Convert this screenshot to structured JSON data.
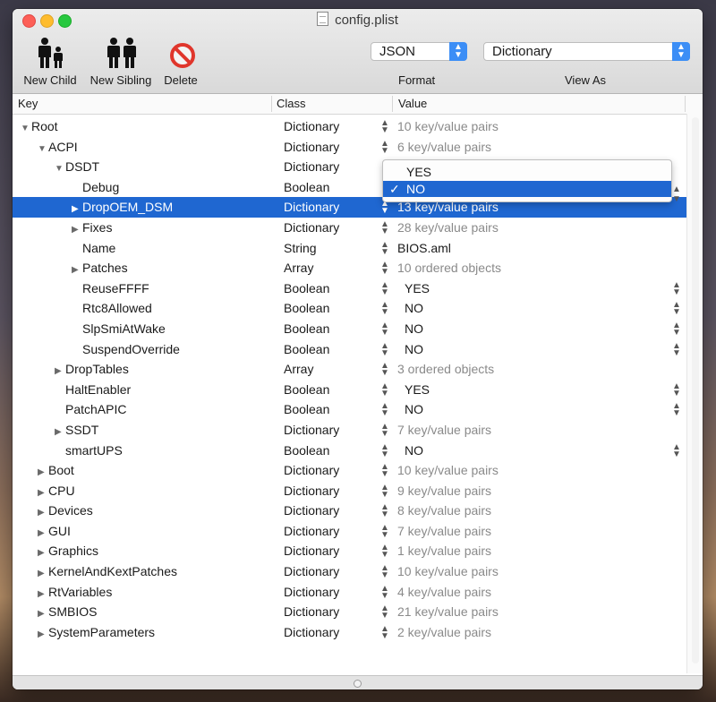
{
  "window": {
    "title": "config.plist"
  },
  "toolbar": {
    "new_child": "New Child",
    "new_sibling": "New Sibling",
    "delete": "Delete",
    "format": {
      "value": "JSON",
      "label": "Format"
    },
    "view_as": {
      "value": "Dictionary",
      "label": "View As"
    }
  },
  "columns": {
    "key": "Key",
    "class": "Class",
    "value": "Value"
  },
  "rows": [
    {
      "key": "Root",
      "indent": 0,
      "expandable": true,
      "expanded": true,
      "class": "Dictionary",
      "value": "10 key/value pairs",
      "kind": "summary"
    },
    {
      "key": "ACPI",
      "indent": 1,
      "expandable": true,
      "expanded": true,
      "class": "Dictionary",
      "value": "6 key/value pairs",
      "kind": "summary"
    },
    {
      "key": "DSDT",
      "indent": 2,
      "expandable": true,
      "expanded": true,
      "class": "Dictionary",
      "value": "",
      "kind": "summary"
    },
    {
      "key": "Debug",
      "indent": 3,
      "expandable": false,
      "class": "Boolean",
      "value": "",
      "kind": "bool"
    },
    {
      "key": "DropOEM_DSM",
      "indent": 3,
      "expandable": true,
      "expanded": false,
      "class": "Dictionary",
      "value": "13 key/value pairs",
      "kind": "summary",
      "selected": true
    },
    {
      "key": "Fixes",
      "indent": 3,
      "expandable": true,
      "expanded": false,
      "class": "Dictionary",
      "value": "28 key/value pairs",
      "kind": "summary"
    },
    {
      "key": "Name",
      "indent": 3,
      "expandable": false,
      "class": "String",
      "value": "BIOS.aml",
      "kind": "string"
    },
    {
      "key": "Patches",
      "indent": 3,
      "expandable": true,
      "expanded": false,
      "class": "Array",
      "value": "10 ordered objects",
      "kind": "summary"
    },
    {
      "key": "ReuseFFFF",
      "indent": 3,
      "expandable": false,
      "class": "Boolean",
      "value": "YES",
      "kind": "bool"
    },
    {
      "key": "Rtc8Allowed",
      "indent": 3,
      "expandable": false,
      "class": "Boolean",
      "value": "NO",
      "kind": "bool"
    },
    {
      "key": "SlpSmiAtWake",
      "indent": 3,
      "expandable": false,
      "class": "Boolean",
      "value": "NO",
      "kind": "bool"
    },
    {
      "key": "SuspendOverride",
      "indent": 3,
      "expandable": false,
      "class": "Boolean",
      "value": "NO",
      "kind": "bool"
    },
    {
      "key": "DropTables",
      "indent": 2,
      "expandable": true,
      "expanded": false,
      "class": "Array",
      "value": "3 ordered objects",
      "kind": "summary"
    },
    {
      "key": "HaltEnabler",
      "indent": 2,
      "expandable": false,
      "class": "Boolean",
      "value": "YES",
      "kind": "bool"
    },
    {
      "key": "PatchAPIC",
      "indent": 2,
      "expandable": false,
      "class": "Boolean",
      "value": "NO",
      "kind": "bool"
    },
    {
      "key": "SSDT",
      "indent": 2,
      "expandable": true,
      "expanded": false,
      "class": "Dictionary",
      "value": "7 key/value pairs",
      "kind": "summary"
    },
    {
      "key": "smartUPS",
      "indent": 2,
      "expandable": false,
      "class": "Boolean",
      "value": "NO",
      "kind": "bool"
    },
    {
      "key": "Boot",
      "indent": 1,
      "expandable": true,
      "expanded": false,
      "class": "Dictionary",
      "value": "10 key/value pairs",
      "kind": "summary"
    },
    {
      "key": "CPU",
      "indent": 1,
      "expandable": true,
      "expanded": false,
      "class": "Dictionary",
      "value": "9 key/value pairs",
      "kind": "summary"
    },
    {
      "key": "Devices",
      "indent": 1,
      "expandable": true,
      "expanded": false,
      "class": "Dictionary",
      "value": "8 key/value pairs",
      "kind": "summary"
    },
    {
      "key": "GUI",
      "indent": 1,
      "expandable": true,
      "expanded": false,
      "class": "Dictionary",
      "value": "7 key/value pairs",
      "kind": "summary"
    },
    {
      "key": "Graphics",
      "indent": 1,
      "expandable": true,
      "expanded": false,
      "class": "Dictionary",
      "value": "1 key/value pairs",
      "kind": "summary"
    },
    {
      "key": "KernelAndKextPatches",
      "indent": 1,
      "expandable": true,
      "expanded": false,
      "class": "Dictionary",
      "value": "10 key/value pairs",
      "kind": "summary"
    },
    {
      "key": "RtVariables",
      "indent": 1,
      "expandable": true,
      "expanded": false,
      "class": "Dictionary",
      "value": "4 key/value pairs",
      "kind": "summary"
    },
    {
      "key": "SMBIOS",
      "indent": 1,
      "expandable": true,
      "expanded": false,
      "class": "Dictionary",
      "value": "21 key/value pairs",
      "kind": "summary"
    },
    {
      "key": "SystemParameters",
      "indent": 1,
      "expandable": true,
      "expanded": false,
      "class": "Dictionary",
      "value": "2 key/value pairs",
      "kind": "summary"
    }
  ],
  "dropdown": {
    "options": [
      "YES",
      "NO"
    ],
    "selected": "NO",
    "check_mark": "✓"
  },
  "colors": {
    "selection": "#1f67d1",
    "accent": "#3c8ef6",
    "delete_red": "#e0362c"
  }
}
